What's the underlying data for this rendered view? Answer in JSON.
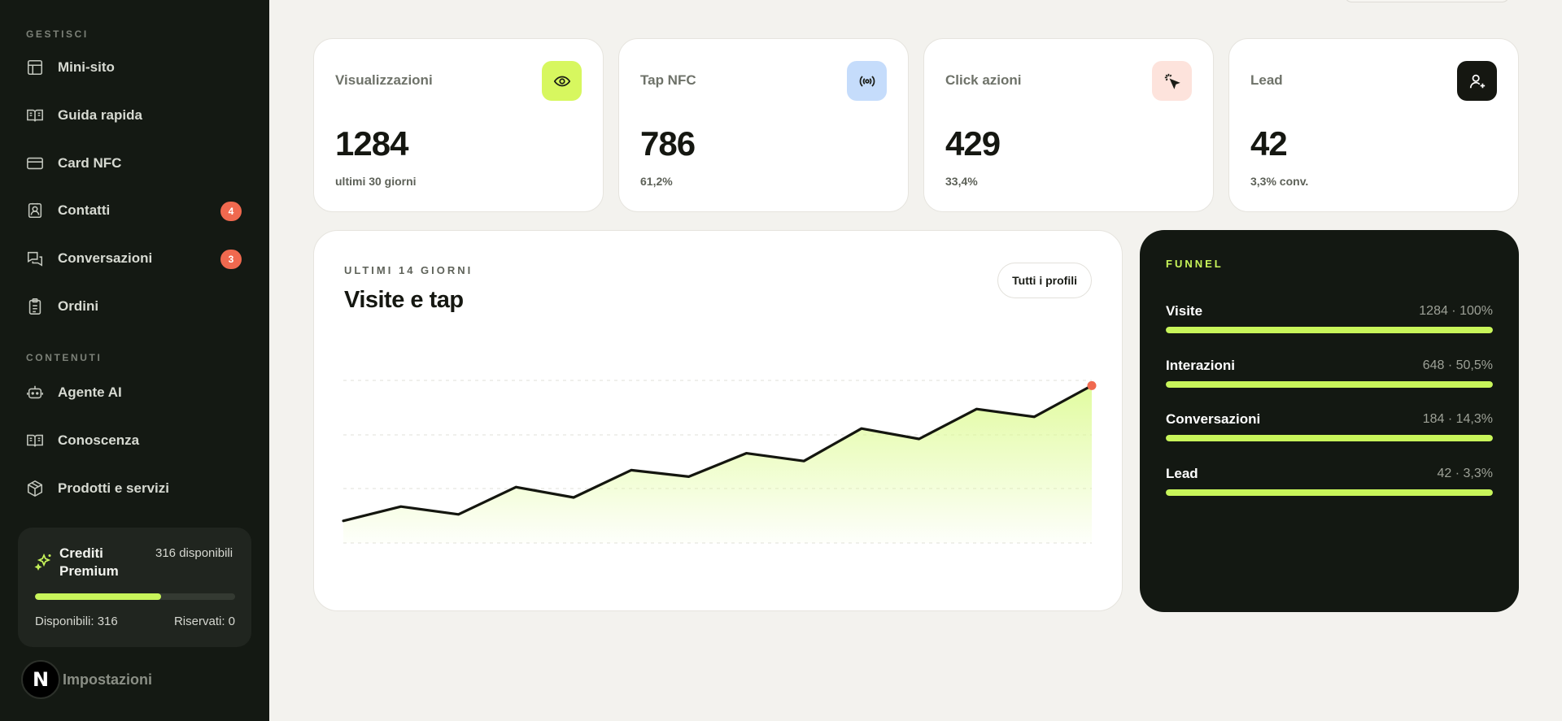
{
  "sidebar": {
    "section_manage": "GESTISCI",
    "section_content": "CONTENUTI",
    "manage_items": [
      {
        "label": "Mini-sito",
        "icon": "layout-icon"
      },
      {
        "label": "Guida rapida",
        "icon": "book-open-icon"
      },
      {
        "label": "Card NFC",
        "icon": "credit-card-icon"
      },
      {
        "label": "Contatti",
        "icon": "contact-icon",
        "badge": "4"
      },
      {
        "label": "Conversazioni",
        "icon": "chat-bubbles-icon",
        "badge": "3"
      },
      {
        "label": "Ordini",
        "icon": "clipboard-icon"
      }
    ],
    "content_items": [
      {
        "label": "Agente AI",
        "icon": "robot-icon"
      },
      {
        "label": "Conoscenza",
        "icon": "book-icon"
      },
      {
        "label": "Prodotti e servizi",
        "icon": "package-icon"
      }
    ],
    "credits": {
      "title": "Crediti Premium",
      "available_text": "316 disponibili",
      "fill_fraction": 0.63,
      "available_label": "Disponibili: 316",
      "reserved_label": "Riservati: 0"
    },
    "settings": {
      "avatar_letter": "N",
      "label": "Impostazioni"
    }
  },
  "stats": [
    {
      "label": "Visualizzazioni",
      "value": "1284",
      "sub": "ultimi 30 giorni",
      "icon": "eye-icon",
      "icon_bg": "#d7f75f",
      "icon_color": "#1a1c16"
    },
    {
      "label": "Tap NFC",
      "value": "786",
      "sub": "61,2%",
      "icon": "nfc-signal-icon",
      "icon_bg": "#c5dcfb",
      "icon_color": "#1a1c16"
    },
    {
      "label": "Click azioni",
      "value": "429",
      "sub": "33,4%",
      "icon": "cursor-click-icon",
      "icon_bg": "#fde3dc",
      "icon_color": "#1a1c16"
    },
    {
      "label": "Lead",
      "value": "42",
      "sub": "3,3% conv.",
      "icon": "user-plus-icon",
      "icon_bg": "#151711",
      "icon_color": "#ffffff"
    }
  ],
  "chart": {
    "eyebrow": "ULTIMI 14 GIORNI",
    "title": "Visite e tap",
    "filter_label": "Tutti i profili"
  },
  "chart_data": {
    "type": "area",
    "title": "Visite e tap",
    "x": [
      1,
      2,
      3,
      4,
      5,
      6,
      7,
      8,
      9,
      10,
      11,
      12,
      13,
      14
    ],
    "values": [
      17,
      28,
      22,
      43,
      35,
      56,
      51,
      69,
      63,
      88,
      80,
      103,
      97,
      121
    ],
    "ylim": [
      0,
      150
    ],
    "grid": "dashed horizontal",
    "line_color": "#14160f",
    "fill_color": "#dcfb8f",
    "end_marker_color": "#f0694f"
  },
  "funnel": {
    "title": "FUNNEL",
    "steps": [
      {
        "name": "Visite",
        "value": "1284 · 100%",
        "fraction": 1.0
      },
      {
        "name": "Interazioni",
        "value": "648 · 50,5%",
        "fraction": 1.0
      },
      {
        "name": "Conversazioni",
        "value": "184 · 14,3%",
        "fraction": 1.0
      },
      {
        "name": "Lead",
        "value": "42 · 3,3%",
        "fraction": 1.0
      }
    ]
  }
}
